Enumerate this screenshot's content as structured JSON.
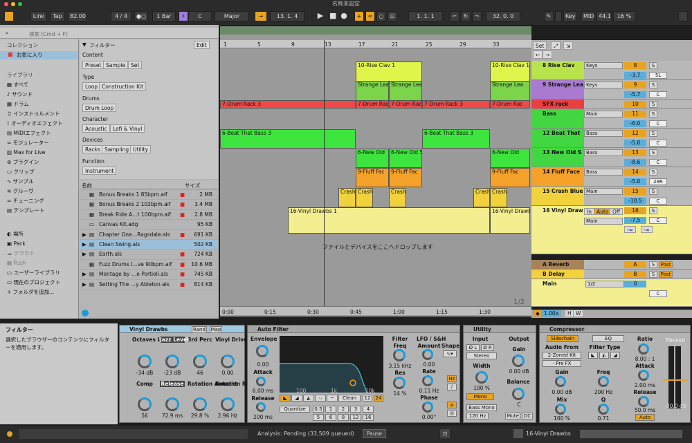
{
  "window": {
    "title": "名称未設定"
  },
  "toolbar": {
    "link": "Link",
    "tap": "Tap",
    "tempo": "82.00",
    "time_sig_num": "4",
    "time_sig_sep": "/",
    "time_sig_den": "4",
    "quantize": "1 Bar",
    "key": "C",
    "scale": "Major",
    "position": "13.  1.  4",
    "loop_start": "1.  1.  1",
    "loop_length": "32.  0.  0",
    "key_label": "Key",
    "midi_label": "MIDI",
    "sample_rate": "44.1",
    "cpu": "16 %"
  },
  "browser": {
    "search_placeholder": "検索 (Cmd + F)",
    "sidebar": {
      "collection_header": "コレクション",
      "favorites": "お気に入り",
      "library_header": "ライブラリ",
      "items": [
        "すべて",
        "サウンド",
        "ドラム",
        "インストゥルメント",
        "オーディオエフェクト",
        "MIDIエフェクト",
        "モジュレーター",
        "Max for Live",
        "プラグイン",
        "クリップ",
        "サンプル",
        "グルーヴ",
        "チューニング",
        "テンプレート"
      ],
      "places_header": "場所",
      "places": [
        "Pack",
        "クラウド",
        "Push",
        "ユーザーライブラリ",
        "現在のプロジェクト",
        "フォルダを追加..."
      ]
    },
    "filter": {
      "title": "フィルター",
      "edit": "Edit",
      "content_label": "Content",
      "content_tags": [
        "Preset",
        "Sample",
        "Set"
      ],
      "type_label": "Type",
      "type_tags": [
        "Loop",
        "Construction Kit"
      ],
      "drums_label": "Drums",
      "drums_tags": [
        "Drum Loop"
      ],
      "character_label": "Character",
      "character_tags": [
        "Acoustic",
        "Lofi & Vinyl"
      ],
      "devices_label": "Devices",
      "devices_tags": [
        "Racks",
        "Sampling",
        "Utility"
      ],
      "function_label": "Function",
      "function_tags": [
        "Instrument"
      ]
    },
    "list_headers": {
      "name": "名前",
      "size": "サイズ"
    },
    "files": [
      {
        "name": "Bonus Breaks 1 85bpm.aif",
        "size": "2 MB"
      },
      {
        "name": "Bonus Breaks 2 102bpm.aif",
        "size": "3.4 MB"
      },
      {
        "name": "Break Ride A…t 100bpm.aif",
        "size": "2.8 MB"
      },
      {
        "name": "Canvas Kit.adg",
        "size": "95 KB"
      },
      {
        "name": "Chapter One…Ragsdale.als",
        "size": "691 KB"
      },
      {
        "name": "Clean Swing.als",
        "size": "502 KB"
      },
      {
        "name": "Earth.als",
        "size": "724 KB"
      },
      {
        "name": "Fuzz Drums I…ve 90bpm.aif",
        "size": "10.6 MB"
      },
      {
        "name": "Montage by …e Portioli.als",
        "size": "745 KB"
      },
      {
        "name": "Setting The …y Ableton.als",
        "size": "814 KB"
      }
    ]
  },
  "arrangement": {
    "bar_numbers": [
      "1",
      "5",
      "9",
      "13",
      "17",
      "21",
      "25",
      "29",
      "33"
    ],
    "time_labels": [
      "0:00",
      "0:15",
      "0:30",
      "0:45",
      "1:00",
      "1:15",
      "1:30"
    ],
    "drop_hint": "ファイルとデバイスをここへドロップします",
    "page": "1/2",
    "set_button": "Set"
  },
  "clips": {
    "rise_clav": "10-Rise Clav 1",
    "strange_lead": "Strange Lea",
    "drum_rack": "7-Drum Rack 3",
    "drum_rack_short": "7-Drum Rac",
    "beat_bass": "6-Beat That Bass 3",
    "new_old": "6-New Old",
    "new_old_s": "6-New Old S",
    "fluff": "9-Fluff Fac",
    "crash": "Crash",
    "vinyl": "16-Vinyl Drawbs 1",
    "vinyl_short": "16-Vinyl Drawb"
  },
  "tracks": [
    {
      "name": "8 Rise Clav",
      "io": "Keys",
      "num": "8",
      "vol": "-3.7",
      "pan": "5L",
      "color": "#b8e34a"
    },
    {
      "name": "9 Strange Lea",
      "io": "Keys",
      "num": "9",
      "vol": "-5.7",
      "pan": "C",
      "color": "#a87ad0"
    },
    {
      "name": "SFX rack",
      "io": "",
      "num": "10",
      "vol": "",
      "pan": "",
      "color": "#e84040"
    },
    {
      "name": "Bass",
      "io": "Main",
      "num": "11",
      "vol": "-6.0",
      "pan": "C",
      "color": "#42d642"
    },
    {
      "name": "12 Beat That",
      "io": "Bass",
      "num": "12",
      "vol": "-5.0",
      "pan": "C",
      "color": "#42d642"
    },
    {
      "name": "13 New Old S",
      "io": "Bass",
      "num": "13",
      "vol": "-8.6",
      "pan": "C",
      "color": "#42d642"
    },
    {
      "name": "14 Fluff Face",
      "io": "Bass",
      "num": "14",
      "vol": "-5.0",
      "pan": "29R",
      "color": "#f4a22a"
    },
    {
      "name": "15 Crash Blue",
      "io": "Main",
      "num": "15",
      "vol": "-10.5",
      "pan": "C",
      "color": "#f2d23c"
    },
    {
      "name": "16 Vinyl Draw",
      "io": "Main",
      "num": "16",
      "vol": "-7.5",
      "pan": "C",
      "color": "#f3ee8f"
    }
  ],
  "io_labels": {
    "in": "In",
    "auto": "Auto",
    "off": "Off",
    "inf": "-∞"
  },
  "returns": [
    {
      "name": "A Reverb",
      "letter": "A",
      "post": "Post"
    },
    {
      "name": "B Delay",
      "letter": "B",
      "post": "Post"
    },
    {
      "name": "Main",
      "io": "1/2",
      "vol": "0",
      "pan": "C"
    }
  ],
  "zoom": {
    "value": "1.00x",
    "h": "H",
    "w": "W"
  },
  "info": {
    "title": "フィルター",
    "text": "選択したブラウザーのコンテンツにフィルターを適用します。"
  },
  "devices": {
    "vinyl": {
      "title": "Vinyl Drawbs",
      "rand": "Rand",
      "map": "Map",
      "macros": [
        {
          "label": "Octaves Level",
          "value": "-34 dB"
        },
        {
          "label": "Jazz Level",
          "value": "-23 dB"
        },
        {
          "label": "3rd Perc",
          "value": "46"
        },
        {
          "label": "Vinyl Drive",
          "value": "0.00"
        },
        {
          "label": "Comp",
          "value": "56"
        },
        {
          "label": "Release",
          "value": "72.9 ms"
        },
        {
          "label": "Rotation Amount",
          "value": "29.8 %"
        },
        {
          "label": "Rotation Rate",
          "value": "2.96 Hz"
        }
      ]
    },
    "autofilter": {
      "title": "Auto Filter",
      "envelope": "Envelope",
      "env_val": "0.00",
      "attack": "Attack",
      "attack_val": "6.00 ms",
      "release": "Release",
      "release_val": "200 ms",
      "filter": "Filter",
      "freq": "Freq",
      "freq_val": "3.15 kHz",
      "res": "Res",
      "res_val": "14 %",
      "lfo": "LFO / S&H",
      "amount": "Amount",
      "amount_val": "0.00",
      "shape": "Shape",
      "rate": "Rate",
      "rate_val": "0.11 Hz",
      "phase": "Phase",
      "phase_val": "0.00°",
      "hz": "Hz",
      "mode": "Clean",
      "slope1": "12",
      "slope2": "24",
      "quantize": "Quantize",
      "q_nums": [
        "0.5",
        "1",
        "2",
        "3",
        "4",
        "5",
        "6",
        "8",
        "12",
        "16"
      ],
      "grid": [
        "100",
        "1k",
        "10k"
      ]
    },
    "utility": {
      "title": "Utility",
      "input": "Input",
      "output": "Output",
      "phase_l": "Ø L",
      "phase_r": "Ø R",
      "stereo": "Stereo",
      "width": "Width",
      "width_val": "100 %",
      "mono": "Mono",
      "gain": "Gain",
      "gain_val": "0.00 dB",
      "balance": "Balance",
      "balance_val": "C",
      "bass_mono": "Bass Mono",
      "bass_freq": "120 Hz",
      "mute": "Mute",
      "dc": "DC"
    },
    "compressor": {
      "title": "Compressor",
      "sidechain": "Sidechain",
      "eq": "EQ",
      "audio_from": "Audio From",
      "source": "2-Zoned Kit",
      "tap": "- Pre FX",
      "gain": "Gain",
      "gain_val": "0.00 dB",
      "mix": "Mix",
      "mix_val": "100 %",
      "filter_type": "Filter Type",
      "freq": "Freq",
      "freq_val": "200 Hz",
      "q": "Q",
      "q_val": "0.71",
      "ratio": "Ratio",
      "ratio_val": "8.00 : 1",
      "attack": "Attack",
      "attack_val": "2.00 ms",
      "release": "Release",
      "release_val": "50.0 ms",
      "auto": "Auto",
      "thresh": "Thresh",
      "thresh_val": "-30.0 dB"
    }
  },
  "status": {
    "analysis": "Analysis: Pending (33,509 queued)",
    "pause": "Pause",
    "track": "16-Vinyl Drawbs"
  }
}
